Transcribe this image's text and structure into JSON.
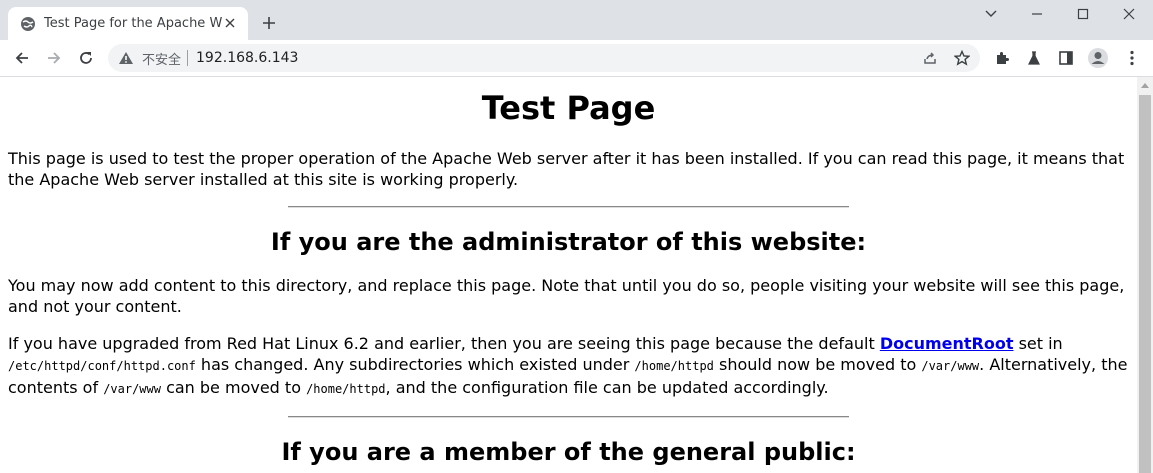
{
  "browser": {
    "tab_title": "Test Page for the Apache Web Server",
    "security_label": "不安全",
    "url": "192.168.6.143"
  },
  "page": {
    "title": "Test Page",
    "intro": "This page is used to test the proper operation of the Apache Web server after it has been installed. If you can read this page, it means that the Apache Web server installed at this site is working properly.",
    "admin_heading": "If you are the administrator of this website:",
    "admin_p1": "You may now add content to this directory, and replace this page. Note that until you do so, people visiting your website will see this page, and not your content.",
    "admin_p2": {
      "t1": "If you have upgraded from Red Hat Linux 6.2 and earlier, then you are seeing this page because the default ",
      "link": "DocumentRoot",
      "t2": " set in ",
      "code1": "/etc/httpd/conf/httpd.conf",
      "t3": " has changed. Any subdirectories which existed under ",
      "code2": "/home/httpd",
      "t4": " should now be moved to ",
      "code3": "/var/www",
      "t5": ". Alternatively, the contents of ",
      "code4": "/var/www",
      "t6": " can be moved to ",
      "code5": "/home/httpd",
      "t7": ", and the configuration file can be updated accordingly."
    },
    "public_heading": "If you are a member of the general public:"
  },
  "icons": {
    "tab_favicon": "globe-icon",
    "warning": "warning-triangle-icon"
  },
  "colors": {
    "tabstrip_bg": "#dee1e6",
    "link": "#0000ee",
    "omnibox_bg": "#f1f3f4"
  }
}
